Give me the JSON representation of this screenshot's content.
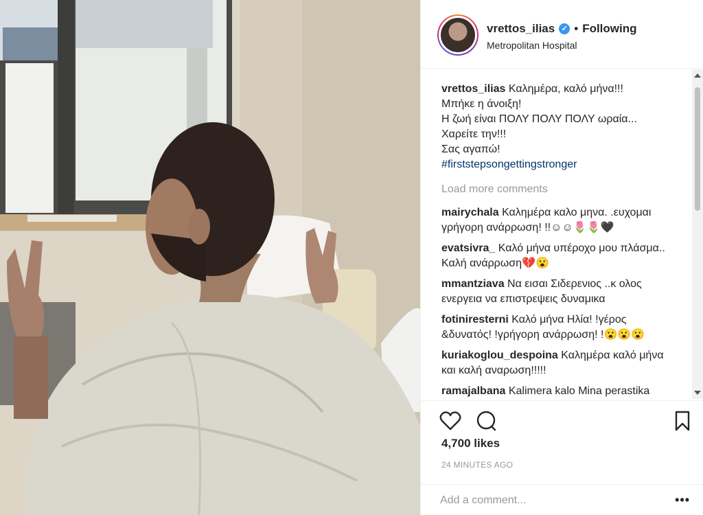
{
  "header": {
    "username": "vrettos_ilias",
    "verified_icon": "verified-badge-icon",
    "separator": "•",
    "follow_status": "Following",
    "location": "Metropolitan Hospital"
  },
  "caption": {
    "username": "vrettos_ilias",
    "lines": [
      "Καλημέρα, καλό μήνα!!!",
      "Μπήκε η άνοιξη!",
      "Η ζωή είναι ΠΟΛΥ ΠΟΛΥ ΠΟΛΥ ωραία...",
      "Χαρείτε την!!!",
      "Σας αγαπώ!"
    ],
    "hashtag": "#firststepsongettingstronger"
  },
  "load_more": "Load more comments",
  "comments": [
    {
      "user": "mairychala",
      "text": "Καλημέρα καλο μηνα. .ευχομαι γρήγορη ανάρρωση! !!☺☺🌷🌷🖤"
    },
    {
      "user": "evatsivra_",
      "text": "Καλό μήνα υπέροχο μου πλάσμα.. Καλή ανάρρωση💔😮"
    },
    {
      "user": "mmantziava",
      "text": "Να εισαι Σιδερενιος ..κ ολος ενεργεια να επιστρεψεις δυναμικα"
    },
    {
      "user": "fotiniresternі",
      "text": "Καλό μήνα Ηλία! !γέρος &δυνατός! !γρήγορη ανάρρωση! !😮😮😮"
    },
    {
      "user": "kuriakoglou_despoina",
      "text": "Καλημέρα καλό μήνα και καλή αναρωση!!!!!"
    },
    {
      "user": "ramajalbana",
      "text": "Kalimera kalo Mina perastika"
    }
  ],
  "actions": {
    "like_icon": "heart-icon",
    "comment_icon": "comment-icon",
    "save_icon": "bookmark-icon"
  },
  "likes": "4,700 likes",
  "timestamp": "24 MINUTES AGO",
  "add_comment": {
    "placeholder": "Add a comment...",
    "more": "•••"
  },
  "colors": {
    "accent": "#3897f0",
    "hashtag": "#003569",
    "muted": "#999999"
  }
}
